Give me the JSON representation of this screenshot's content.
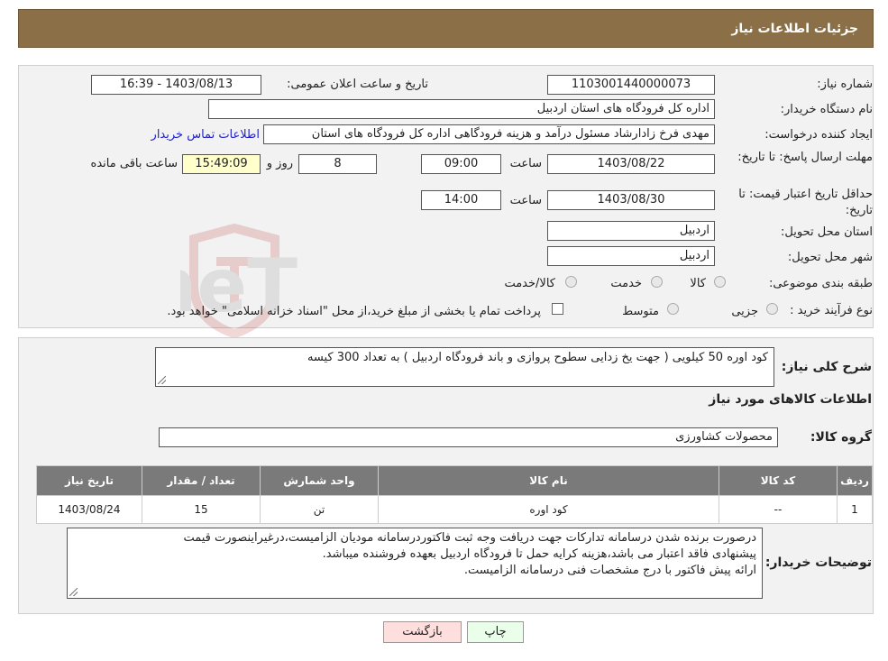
{
  "header": {
    "title": "جزئیات اطلاعات نیاز"
  },
  "form": {
    "need_number_label": "شماره نیاز:",
    "need_number": "1103001440000073",
    "announce_label": "تاریخ و ساعت اعلان عمومی:",
    "announce_value": "1403/08/13 - 16:39",
    "buyer_org_label": "نام دستگاه خریدار:",
    "buyer_org": "اداره کل فرودگاه های استان اردبیل",
    "creator_label": "ایجاد کننده درخواست:",
    "creator": "مهدی فرخ زادارشاد مسئول درآمد و هزینه فرودگاهی اداره کل فرودگاه های استان",
    "contact_link": "اطلاعات تماس خریدار",
    "deadline_label": "مهلت ارسال پاسخ: تا تاریخ:",
    "deadline_date": "1403/08/22",
    "time_label": "ساعت",
    "deadline_time": "09:00",
    "days_count": "8",
    "days_label": "روز و",
    "remaining_time": "15:49:09",
    "remaining_label": "ساعت باقی مانده",
    "validity_label": "حداقل تاریخ اعتبار قیمت: تا تاریخ:",
    "validity_date": "1403/08/30",
    "validity_time": "14:00",
    "province_label": "استان محل تحویل:",
    "province": "اردبیل",
    "city_label": "شهر محل تحویل:",
    "city": "اردبیل",
    "category_label": "طبقه بندی موضوعی:",
    "category_options": [
      "کالا",
      "خدمت",
      "کالا/خدمت"
    ],
    "process_label": "نوع فرآیند خرید :",
    "process_options": [
      "جزیی",
      "متوسط"
    ],
    "payment_note": "پرداخت تمام یا بخشی از مبلغ خرید،از محل \"اسناد خزانه اسلامی\" خواهد بود."
  },
  "summary": {
    "label": "شرح کلی نیاز:",
    "text": "کود اوره 50 کیلویی ( جهت یخ زدایی سطوح پروازی و باند فرودگاه اردبیل ) به تعداد 300 کیسه"
  },
  "goods": {
    "title": "اطلاعات کالاهای مورد نیاز",
    "group_label": "گروه کالا:",
    "group_value": "محصولات کشاورزی"
  },
  "table": {
    "headers": [
      "ردیف",
      "کد کالا",
      "نام کالا",
      "واحد شمارش",
      "تعداد / مقدار",
      "تاریخ نیاز"
    ],
    "rows": [
      [
        "1",
        "--",
        "کود اوره",
        "تن",
        "15",
        "1403/08/24"
      ]
    ]
  },
  "notes": {
    "label": "توضیحات خریدار:",
    "lines": [
      "درصورت برنده شدن درسامانه تدارکات جهت دریافت وجه ثبت فاکتوردرسامانه مودیان الزامیست،درغیراینصورت قیمت",
      "پیشنهادی فاقد اعتبار می باشد،هزینه کرایه حمل تا فرودگاه اردبیل بعهده فروشنده میباشد.",
      "ارائه پیش فاکتور با درج مشخصات فنی درسامانه الزامیست."
    ]
  },
  "buttons": {
    "print": "چاپ",
    "back": "بازگشت"
  },
  "watermark": {
    "text": "AriaTender.neT"
  },
  "colors": {
    "header_bg": "#8b6f47",
    "table_header_bg": "#7a7a7a",
    "back_button_bg": "#ffdede",
    "print_button_bg": "#eaffea"
  }
}
